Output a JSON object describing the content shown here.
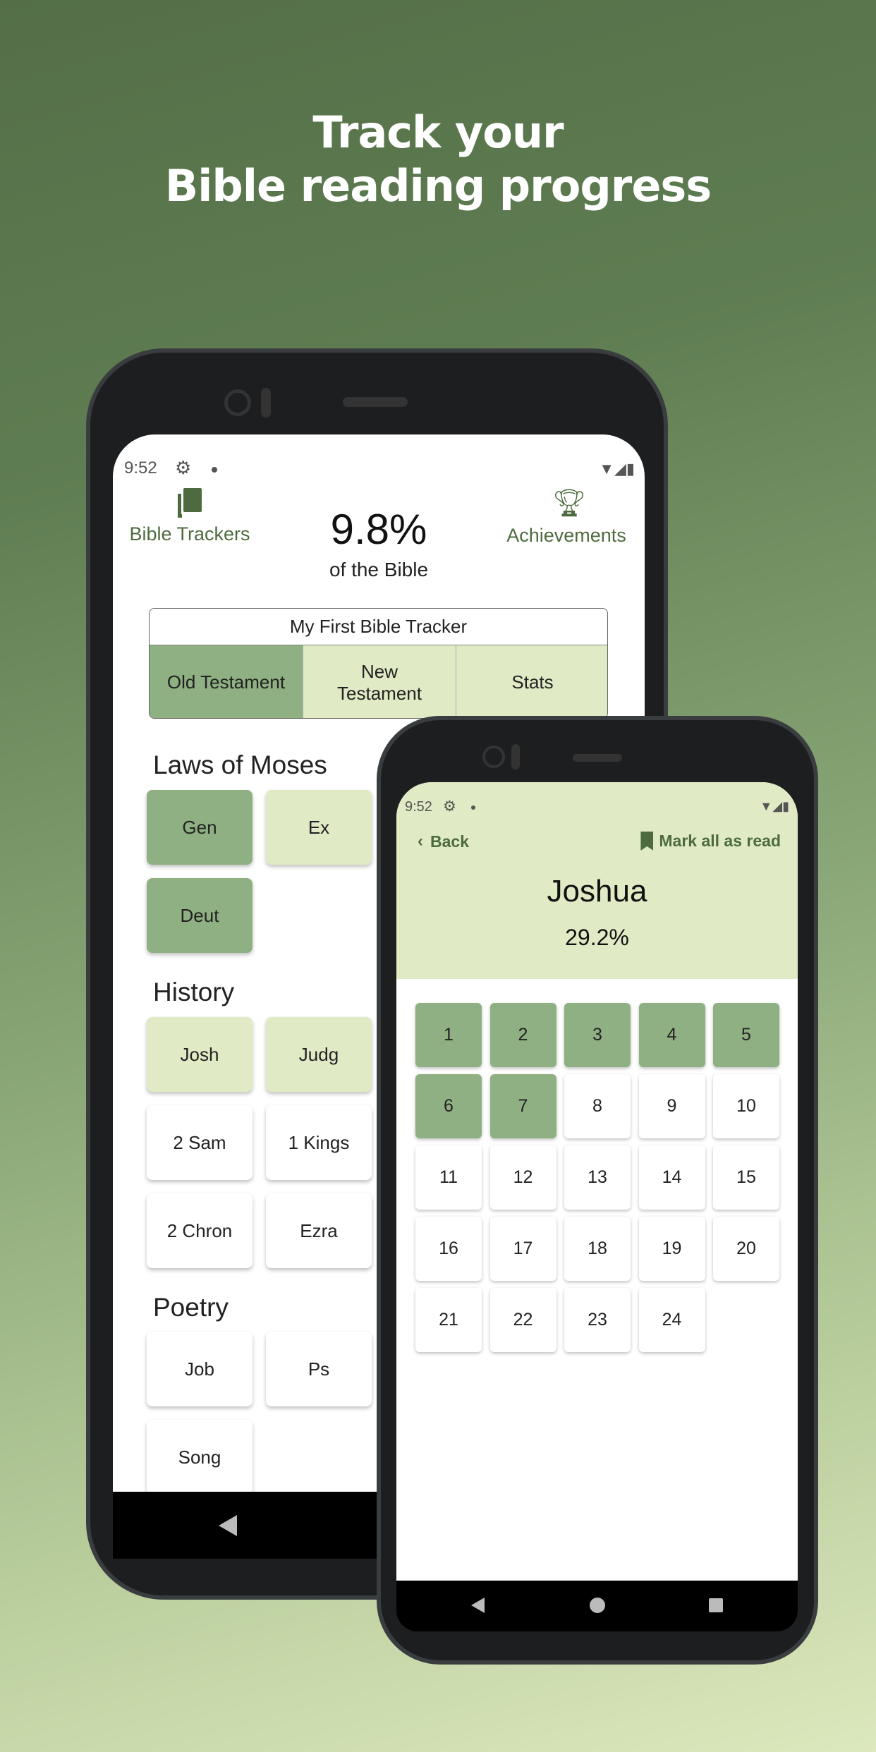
{
  "headline": {
    "line1": "Track your",
    "line2": "Bible reading progress"
  },
  "colors": {
    "read": "#8fb083",
    "partial": "#e0ebc5",
    "accent": "#4d6b3f"
  },
  "phone1": {
    "status": {
      "time": "9:52"
    },
    "header": {
      "trackers_label": "Bible Trackers",
      "trackers_icon": "books-icon",
      "percent": "9.8%",
      "percent_caption": "of the Bible",
      "achievements_label": "Achievements",
      "achievements_icon": "trophy-icon"
    },
    "tracker": {
      "title": "My First Bible Tracker",
      "tabs": [
        {
          "label": "Old Testament",
          "active": true
        },
        {
          "label": "New Testament",
          "active": false
        },
        {
          "label": "Stats",
          "active": false
        }
      ]
    },
    "sections": [
      {
        "title": "Laws of Moses",
        "books": [
          {
            "label": "Gen",
            "state": "read"
          },
          {
            "label": "Ex",
            "state": "partial"
          },
          {
            "label": "Deut",
            "state": "read"
          }
        ]
      },
      {
        "title": "History",
        "books": [
          {
            "label": "Josh",
            "state": "partial"
          },
          {
            "label": "Judg",
            "state": "partial"
          },
          {
            "label": "2 Sam",
            "state": "unread"
          },
          {
            "label": "1 Kings",
            "state": "unread"
          },
          {
            "label": "2 Chron",
            "state": "unread"
          },
          {
            "label": "Ezra",
            "state": "unread"
          }
        ]
      },
      {
        "title": "Poetry",
        "books": [
          {
            "label": "Job",
            "state": "unread"
          },
          {
            "label": "Ps",
            "state": "unread"
          },
          {
            "label": "Song",
            "state": "unread"
          }
        ]
      }
    ]
  },
  "phone2": {
    "status": {
      "time": "9:52"
    },
    "back_label": "Back",
    "mark_all_label": "Mark all as read",
    "book_title": "Joshua",
    "book_percent": "29.2%",
    "chapters": [
      "1",
      "2",
      "3",
      "4",
      "5",
      "6",
      "7",
      "8",
      "9",
      "10",
      "11",
      "12",
      "13",
      "14",
      "15",
      "16",
      "17",
      "18",
      "19",
      "20",
      "21",
      "22",
      "23",
      "24"
    ],
    "read_chapters": 7
  }
}
